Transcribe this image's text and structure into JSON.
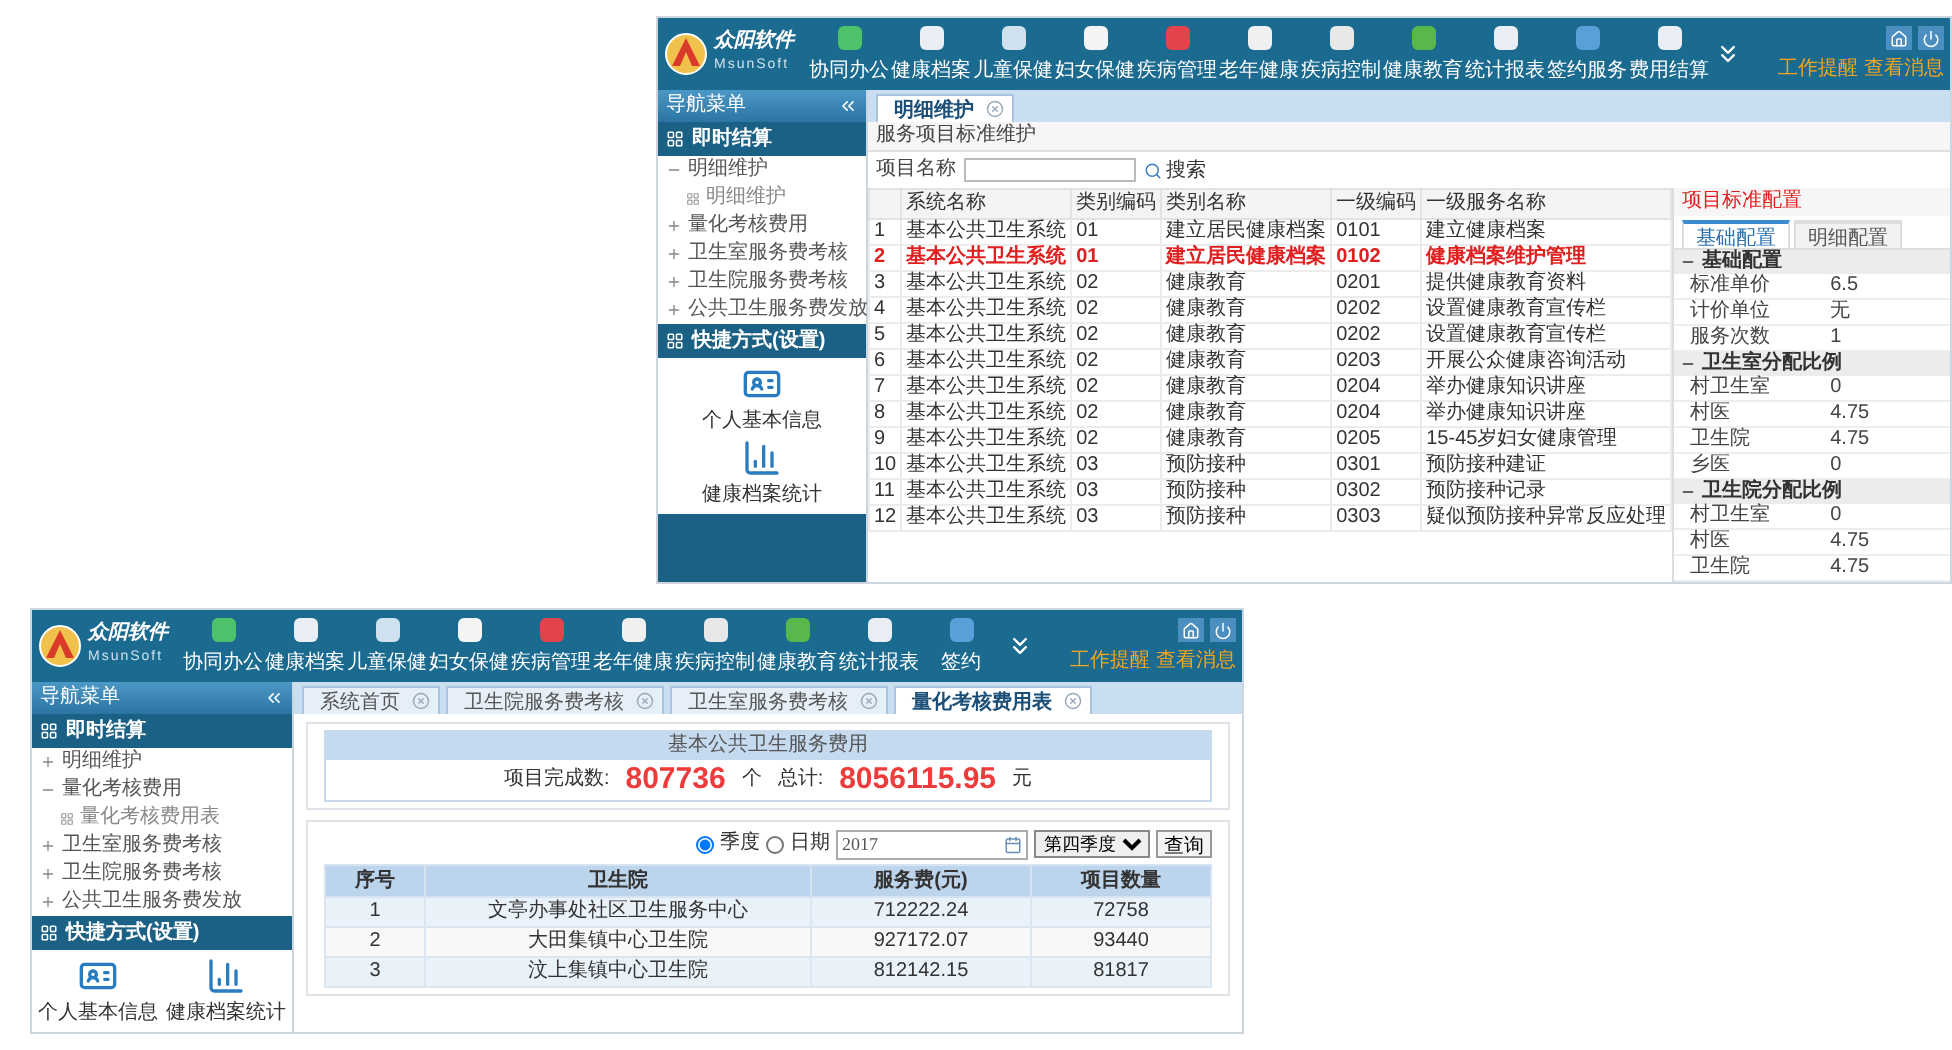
{
  "top_window": {
    "logo": {
      "name": "众阳软件",
      "subtitle": "MsunSoft"
    },
    "nav": [
      "协同办公",
      "健康档案",
      "儿童保健",
      "妇女保健",
      "疾病管理",
      "老年健康",
      "疾病控制",
      "健康教育",
      "统计报表",
      "签约服务",
      "费用结算"
    ],
    "header_links": [
      "工作提醒",
      "查看消息"
    ],
    "sidebar": {
      "title": "导航菜单",
      "sections": [
        {
          "label": "即时结算",
          "items": [
            {
              "label": "明细维护",
              "expanded": true,
              "children": [
                {
                  "label": "明细维护"
                }
              ]
            },
            {
              "label": "量化考核费用",
              "expanded": false
            },
            {
              "label": "卫生室服务费考核",
              "expanded": false
            },
            {
              "label": "卫生院服务费考核",
              "expanded": false
            },
            {
              "label": "公共卫生服务费发放",
              "expanded": false
            }
          ]
        },
        {
          "label": "快捷方式(设置)"
        }
      ],
      "shortcuts": [
        "个人基本信息",
        "健康档案统计"
      ]
    },
    "tabs": [
      {
        "label": "明细维护",
        "selected": true
      }
    ],
    "breadcrumb": "服务项目标准维护",
    "search": {
      "label": "项目名称",
      "button": "搜索"
    },
    "table": {
      "columns": [
        "系统名称",
        "类别编码",
        "类别名称",
        "一级编码",
        "一级服务名称"
      ],
      "rows": [
        {
          "index": "1",
          "selected": false,
          "cells": [
            "基本公共卫生系统",
            "01",
            "建立居民健康档案",
            "0101",
            "建立健康档案"
          ]
        },
        {
          "index": "2",
          "selected": true,
          "cells": [
            "基本公共卫生系统",
            "01",
            "建立居民健康档案",
            "0102",
            "健康档案维护管理"
          ]
        },
        {
          "index": "3",
          "selected": false,
          "cells": [
            "基本公共卫生系统",
            "02",
            "健康教育",
            "0201",
            "提供健康教育资料"
          ]
        },
        {
          "index": "4",
          "selected": false,
          "cells": [
            "基本公共卫生系统",
            "02",
            "健康教育",
            "0202",
            "设置健康教育宣传栏"
          ]
        },
        {
          "index": "5",
          "selected": false,
          "cells": [
            "基本公共卫生系统",
            "02",
            "健康教育",
            "0202",
            "设置健康教育宣传栏"
          ]
        },
        {
          "index": "6",
          "selected": false,
          "cells": [
            "基本公共卫生系统",
            "02",
            "健康教育",
            "0203",
            "开展公众健康咨询活动"
          ]
        },
        {
          "index": "7",
          "selected": false,
          "cells": [
            "基本公共卫生系统",
            "02",
            "健康教育",
            "0204",
            "举办健康知识讲座"
          ]
        },
        {
          "index": "8",
          "selected": false,
          "cells": [
            "基本公共卫生系统",
            "02",
            "健康教育",
            "0204",
            "举办健康知识讲座"
          ]
        },
        {
          "index": "9",
          "selected": false,
          "cells": [
            "基本公共卫生系统",
            "02",
            "健康教育",
            "0205",
            "15-45岁妇女健康管理"
          ]
        },
        {
          "index": "10",
          "selected": false,
          "cells": [
            "基本公共卫生系统",
            "03",
            "预防接种",
            "0301",
            "预防接种建证"
          ]
        },
        {
          "index": "11",
          "selected": false,
          "cells": [
            "基本公共卫生系统",
            "03",
            "预防接种",
            "0302",
            "预防接种记录"
          ]
        },
        {
          "index": "12",
          "selected": false,
          "cells": [
            "基本公共卫生系统",
            "03",
            "预防接种",
            "0303",
            "疑似预防接种异常反应处理"
          ]
        }
      ]
    },
    "detail": {
      "title": "项目标准配置",
      "tabs": [
        {
          "label": "基础配置",
          "selected": true
        },
        {
          "label": "明细配置",
          "selected": false
        }
      ],
      "groups": [
        {
          "label": "基础配置",
          "expanded": true,
          "rows": [
            {
              "name": "标准单价",
              "value": "6.5"
            },
            {
              "name": "计价单位",
              "value": "无"
            },
            {
              "name": "服务次数",
              "value": "1"
            }
          ]
        },
        {
          "label": "卫生室分配比例",
          "expanded": true,
          "rows": [
            {
              "name": "村卫生室",
              "value": "0"
            },
            {
              "name": "村医",
              "value": "4.75"
            },
            {
              "name": "卫生院",
              "value": "4.75"
            },
            {
              "name": "乡医",
              "value": "0"
            }
          ]
        },
        {
          "label": "卫生院分配比例",
          "expanded": true,
          "rows": [
            {
              "name": "村卫生室",
              "value": "0"
            },
            {
              "name": "村医",
              "value": "4.75"
            },
            {
              "name": "卫生院",
              "value": "4.75"
            }
          ]
        }
      ]
    }
  },
  "bottom_window": {
    "logo": {
      "name": "众阳软件",
      "subtitle": "MsunSoft"
    },
    "nav": [
      "协同办公",
      "健康档案",
      "儿童保健",
      "妇女保健",
      "疾病管理",
      "老年健康",
      "疾病控制",
      "健康教育",
      "统计报表",
      "签约"
    ],
    "header_links": [
      "工作提醒",
      "查看消息"
    ],
    "sidebar": {
      "title": "导航菜单",
      "sections": [
        {
          "label": "即时结算",
          "items": [
            {
              "label": "明细维护",
              "expanded": false
            },
            {
              "label": "量化考核费用",
              "expanded": true,
              "children": [
                {
                  "label": "量化考核费用表"
                }
              ]
            },
            {
              "label": "卫生室服务费考核",
              "expanded": false
            },
            {
              "label": "卫生院服务费考核",
              "expanded": false
            },
            {
              "label": "公共卫生服务费发放",
              "expanded": false
            }
          ]
        },
        {
          "label": "快捷方式(设置)"
        }
      ],
      "shortcuts": [
        "个人基本信息",
        "健康档案统计"
      ]
    },
    "tabs": [
      {
        "label": "系统首页",
        "selected": false
      },
      {
        "label": "卫生院服务费考核",
        "selected": false
      },
      {
        "label": "卫生室服务费考核",
        "selected": false
      },
      {
        "label": "量化考核费用表",
        "selected": true
      }
    ],
    "summary": {
      "title": "基本公共卫生服务费用",
      "items": [
        {
          "label": "项目完成数:",
          "value": "807736",
          "unit": "个"
        },
        {
          "label": "总计:",
          "value": "8056115.95",
          "unit": "元"
        }
      ]
    },
    "filter": {
      "options": [
        {
          "label": "季度",
          "selected": true
        },
        {
          "label": "日期",
          "selected": false
        }
      ],
      "date": "2017",
      "period": "第四季度",
      "button": "查询"
    },
    "table": {
      "columns": [
        "序号",
        "卫生院",
        "服务费(元)",
        "项目数量"
      ],
      "rows": [
        [
          "1",
          "文亭办事处社区卫生服务中心",
          "712222.24",
          "72758"
        ],
        [
          "2",
          "大田集镇中心卫生院",
          "927172.07",
          "93440"
        ],
        [
          "3",
          "汶上集镇中心卫生院",
          "812142.15",
          "81817"
        ]
      ]
    }
  }
}
